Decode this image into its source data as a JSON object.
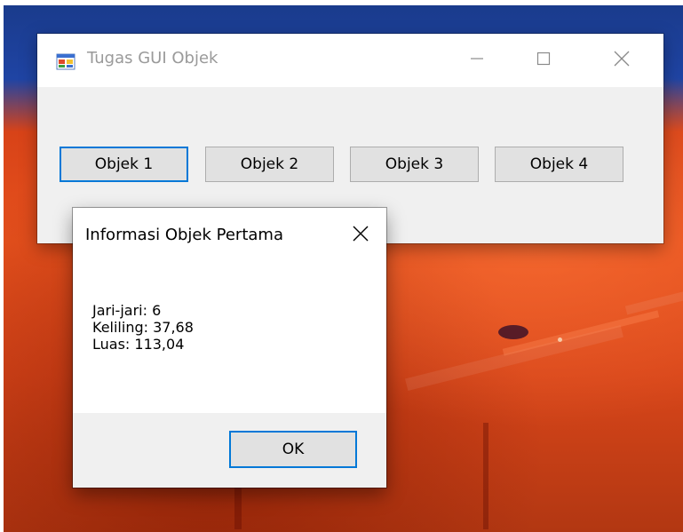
{
  "window": {
    "title": "Tugas GUI Objek"
  },
  "buttons": [
    {
      "label": "Objek 1",
      "focused": true
    },
    {
      "label": "Objek 2",
      "focused": false
    },
    {
      "label": "Objek 3",
      "focused": false
    },
    {
      "label": "Objek 4",
      "focused": false
    }
  ],
  "dialog": {
    "title": "Informasi Objek Pertama",
    "lines": [
      "Jari-jari: 6",
      "Keliling: 37,68",
      "Luas: 113,04"
    ],
    "ok_label": "OK"
  },
  "icons": {
    "app": "app-window-icon",
    "minimize": "minimize-icon",
    "maximize": "maximize-icon",
    "close": "close-icon"
  },
  "colors": {
    "accent": "#0078d7",
    "button_face": "#e1e1e1",
    "window_bg": "#f0f0f0"
  }
}
